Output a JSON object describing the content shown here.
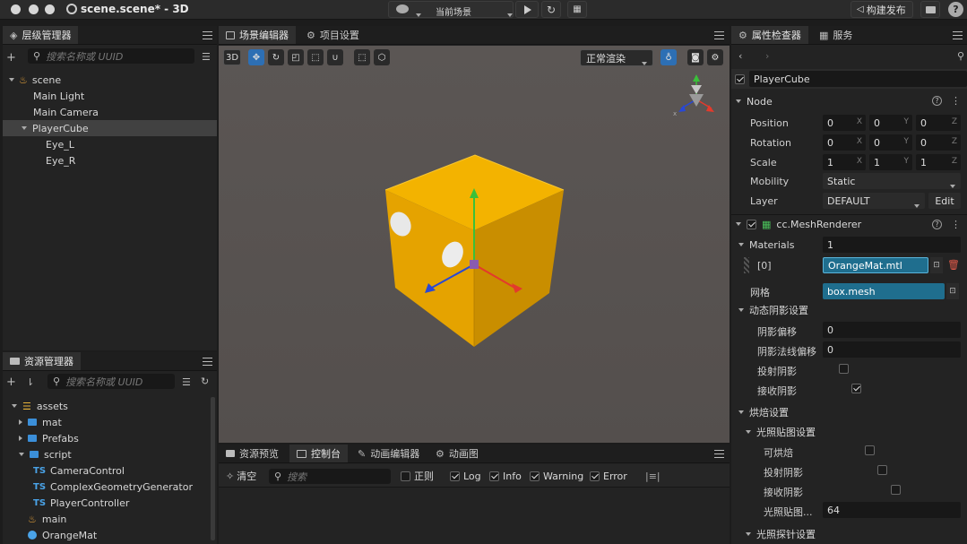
{
  "window": {
    "title": "scene.scene* - 3D",
    "scene_select": "当前场景",
    "build_label": "构建发布"
  },
  "hierarchy": {
    "tab": "层级管理器",
    "search_placeholder": "搜索名称或 UUID",
    "items": [
      "scene",
      "Main Light",
      "Main Camera",
      "PlayerCube",
      "Eye_L",
      "Eye_R"
    ]
  },
  "scene_editor": {
    "tabs": [
      "场景编辑器",
      "项目设置"
    ],
    "btn3d": "3D",
    "render_mode": "正常渲染"
  },
  "assets": {
    "tab": "资源管理器",
    "search_placeholder": "搜索名称或 UUID",
    "items": [
      "assets",
      "mat",
      "Prefabs",
      "script",
      "CameraControl",
      "ComplexGeometryGenerator",
      "PlayerController",
      "main",
      "OrangeMat"
    ],
    "ts_badge": "TS"
  },
  "console": {
    "tabs": [
      "资源预览",
      "控制台",
      "动画编辑器",
      "动画图"
    ],
    "clear": "清空",
    "search_placeholder": "搜索",
    "filters": [
      "正则",
      "Log",
      "Info",
      "Warning",
      "Error"
    ],
    "filter_checked": [
      false,
      true,
      true,
      true,
      true
    ]
  },
  "inspector": {
    "tabs": [
      "属性检查器",
      "服务"
    ],
    "node_name": "PlayerCube",
    "node_section": "Node",
    "position": [
      "0",
      "0",
      "0"
    ],
    "rotation": [
      "0",
      "0",
      "0"
    ],
    "scale": [
      "1",
      "1",
      "1"
    ],
    "axes": [
      "X",
      "Y",
      "Z"
    ],
    "labels": {
      "position": "Position",
      "rotation": "Rotation",
      "scale": "Scale",
      "mobility": "Mobility",
      "layer": "Layer"
    },
    "mobility": "Static",
    "layer": "DEFAULT",
    "edit": "Edit",
    "mesh_renderer": "cc.MeshRenderer",
    "materials_label": "Materials",
    "materials_count": "1",
    "mat_index": "[0]",
    "mat_value": "OrangeMat.mtl",
    "mesh_label": "网格",
    "mesh_value": "box.mesh",
    "dyn_shadow": "动态阴影设置",
    "shadow_bias": "阴影偏移",
    "shadow_bias_v": "0",
    "shadow_normal_bias": "阴影法线偏移",
    "shadow_normal_bias_v": "0",
    "cast_shadow": "投射阴影",
    "recv_shadow": "接收阴影",
    "bake": "烘焙设置",
    "lightmap": "光照贴图设置",
    "bakeable": "可烘焙",
    "lm_cast": "投射阴影",
    "lm_recv": "接收阴影",
    "lm_size": "光照贴图...",
    "lm_size_v": "64",
    "probe": "光照探针设置"
  },
  "colors": {
    "accent": "#2d6fb4",
    "cube_top": "#f4b400",
    "cube_left": "#e6a200",
    "cube_right": "#c98d00"
  }
}
